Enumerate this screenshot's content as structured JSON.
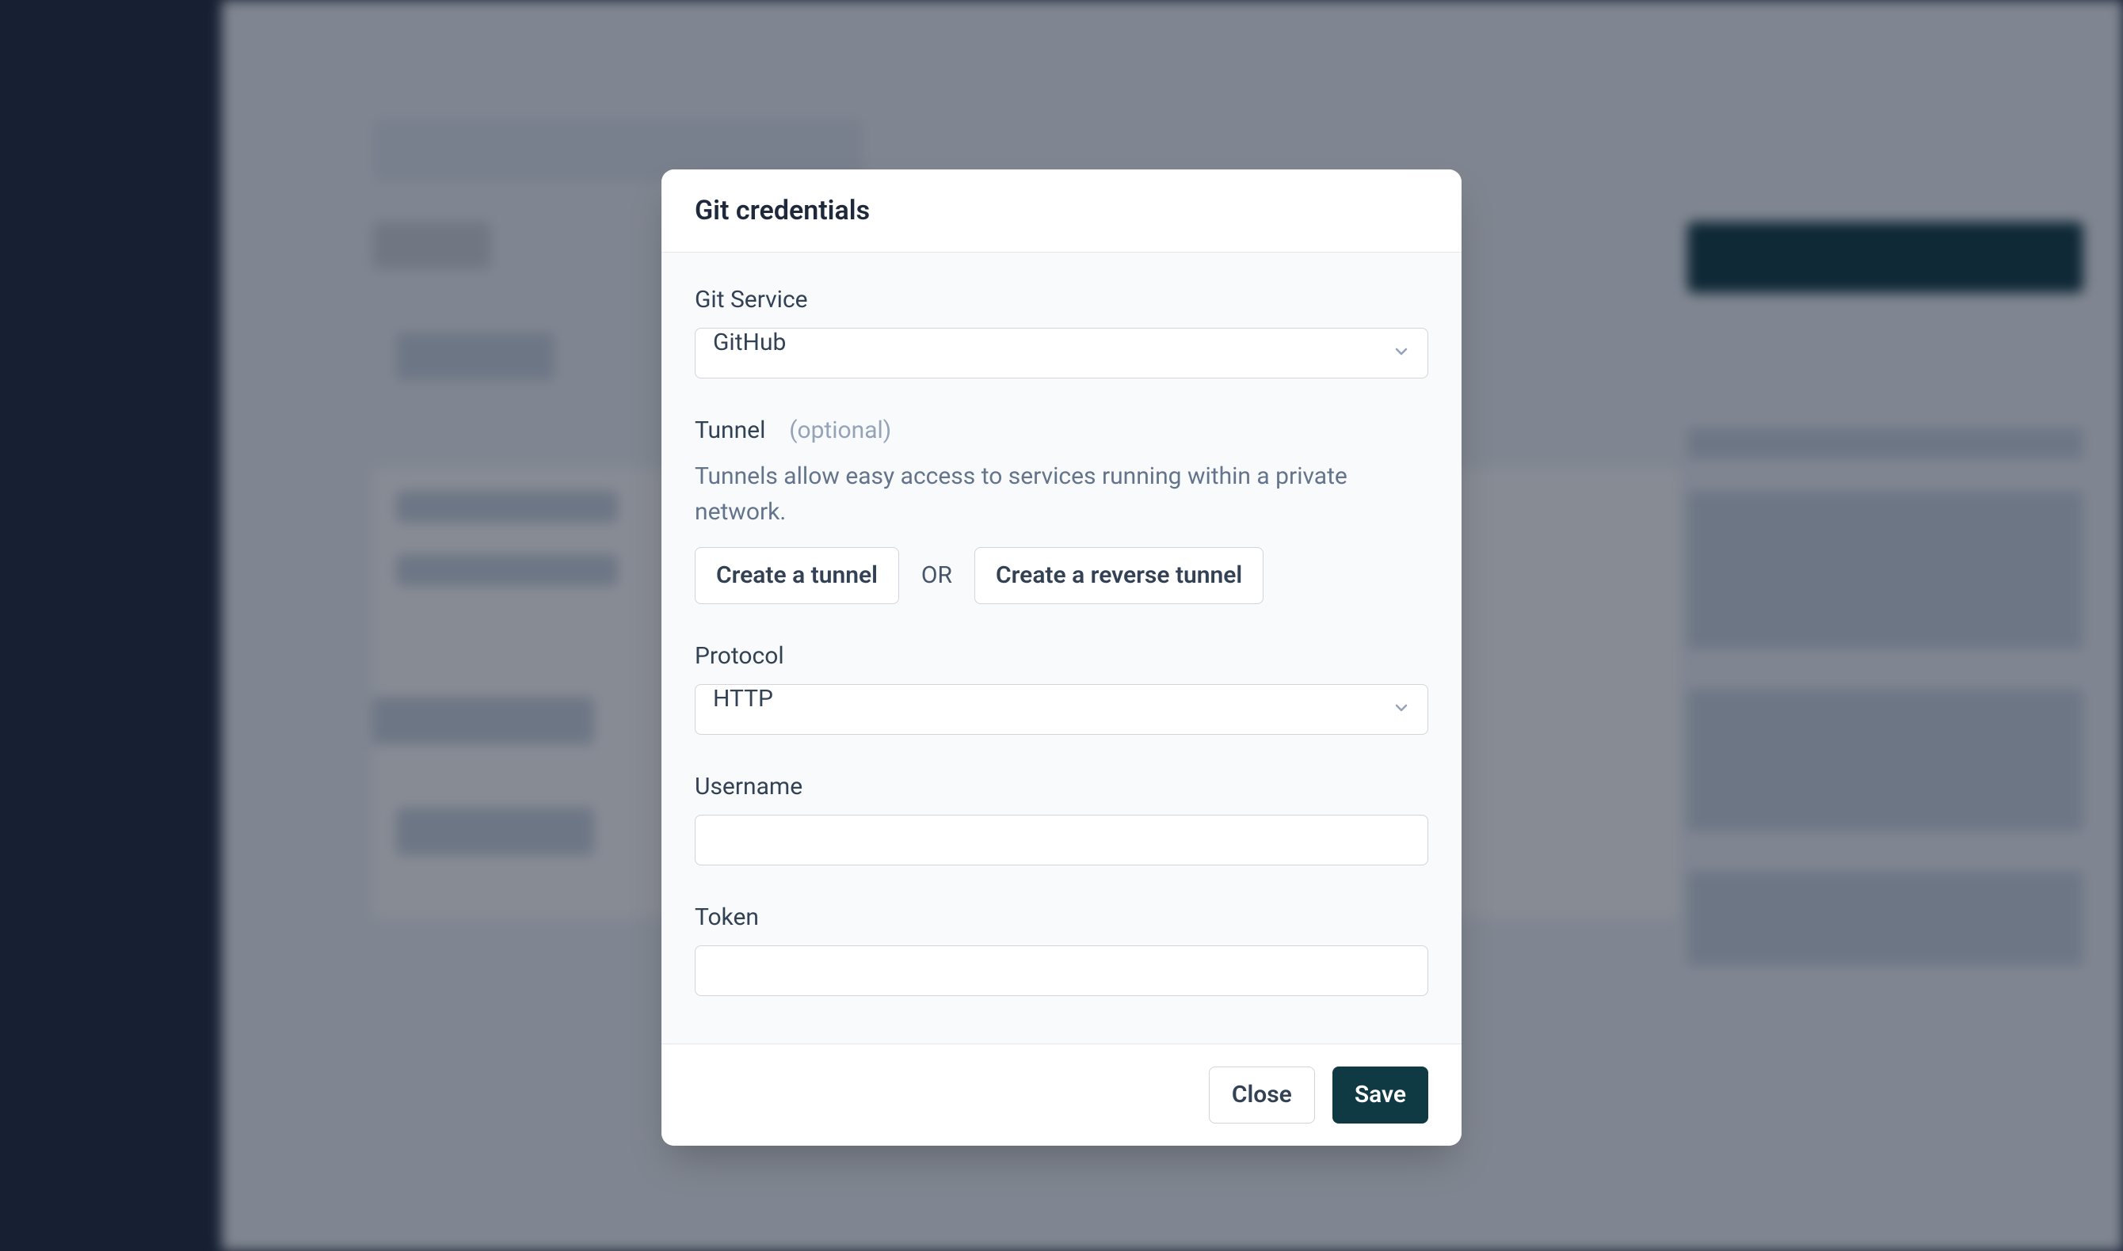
{
  "modal": {
    "title": "Git credentials",
    "gitService": {
      "label": "Git Service",
      "value": "GitHub"
    },
    "tunnel": {
      "label": "Tunnel",
      "optional": "(optional)",
      "description": "Tunnels allow easy access to services running within a private network.",
      "createTunnel": "Create a tunnel",
      "or": "OR",
      "createReverseTunnel": "Create a reverse tunnel"
    },
    "protocol": {
      "label": "Protocol",
      "value": "HTTP"
    },
    "username": {
      "label": "Username",
      "value": ""
    },
    "token": {
      "label": "Token",
      "value": ""
    },
    "footer": {
      "close": "Close",
      "save": "Save"
    }
  }
}
